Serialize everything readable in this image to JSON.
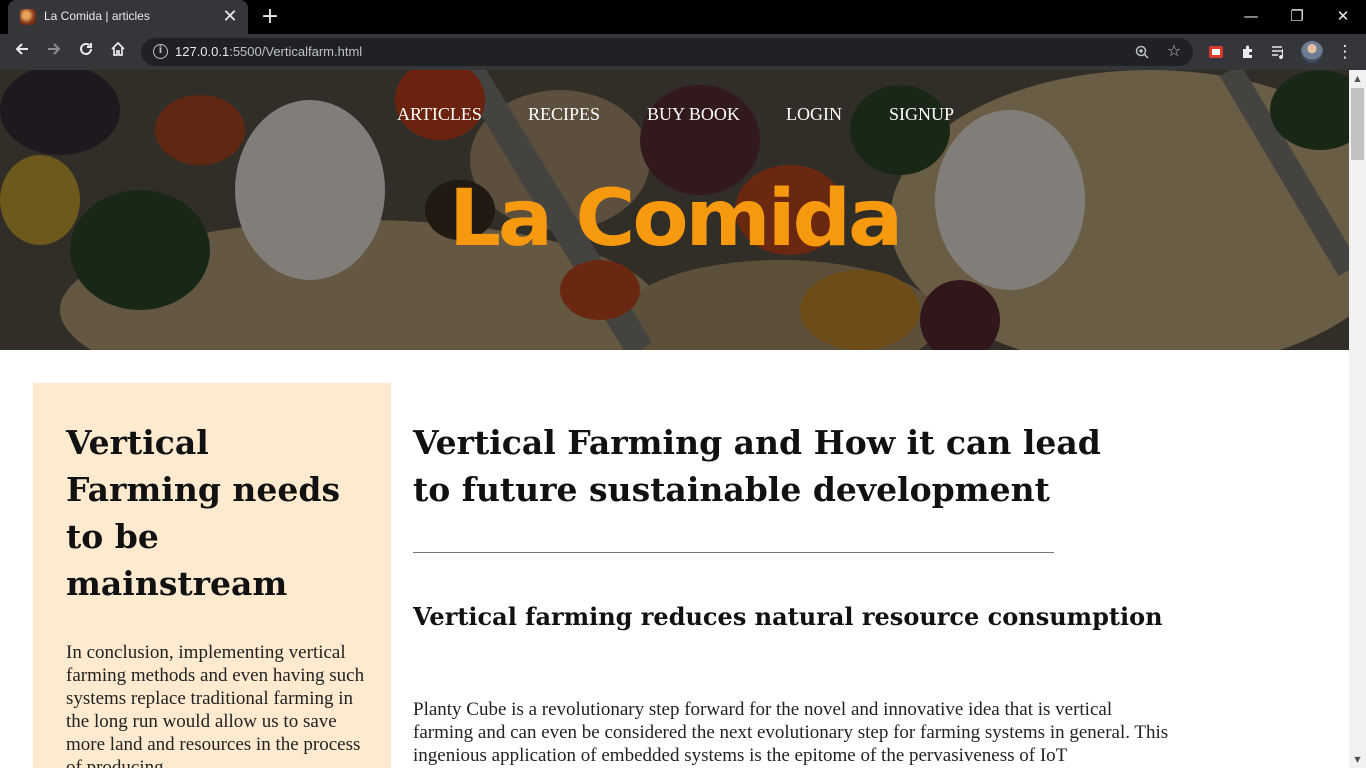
{
  "browser": {
    "tab_title": "La Comida | articles",
    "tab_close": "✕",
    "new_tab": "+",
    "url_host": "127.0.0.1",
    "url_rest": ":5500/Verticalfarm.html",
    "window_controls": {
      "minimize": "—",
      "restore": "❐",
      "close": "✕"
    },
    "icons": [
      "back-icon",
      "forward-icon",
      "reload-icon",
      "home-icon",
      "info-icon",
      "zoom-icon",
      "star-icon",
      "extension-icon",
      "puzzle-icon",
      "media-icon",
      "avatar",
      "menu-icon"
    ]
  },
  "nav": {
    "items": [
      "ARTICLES",
      "RECIPES",
      "BUY BOOK",
      "LOGIN",
      "SIGNUP"
    ]
  },
  "hero": {
    "brand": "La Comida"
  },
  "aside": {
    "title": "Vertical Farming needs to be mainstream",
    "text": "In conclusion, implementing vertical farming methods and even having such systems replace traditional farming in the long run would allow us to save more land and resources in the process of producing"
  },
  "article": {
    "title": "Vertical Farming and How it can lead to future sustainable development",
    "subtitle": "Vertical farming reduces natural resource consumption",
    "text": "Planty Cube is a revolutionary step forward for the novel and innovative idea that is vertical farming and can even be considered the next evolutionary step for farming systems in general. This ingenious application of embedded systems is the epitome of the pervasiveness of IoT"
  },
  "colors": {
    "brand": "#f7990f",
    "aside_bg": "#fdeacf",
    "chrome_dark": "#35363a"
  }
}
